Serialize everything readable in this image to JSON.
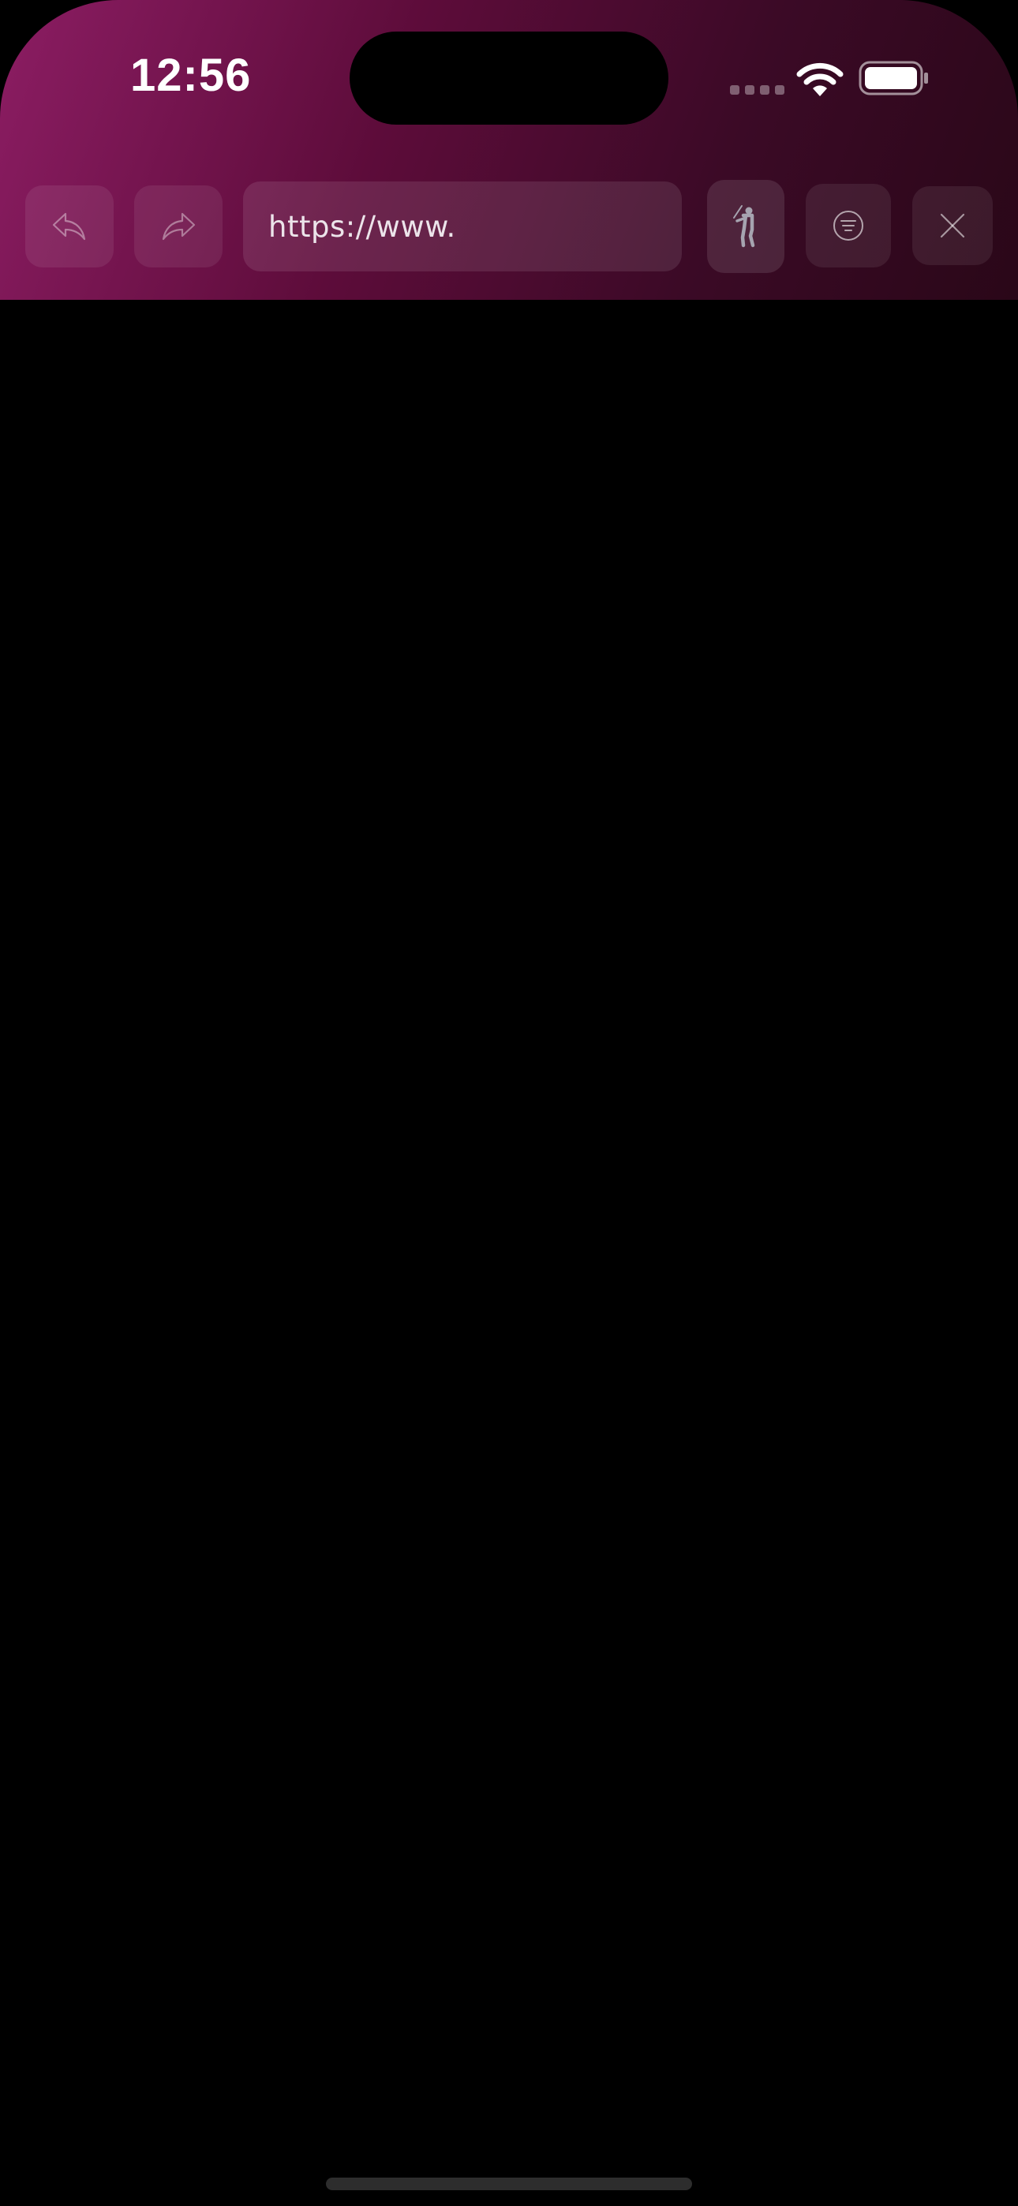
{
  "status_bar": {
    "time": "12:56",
    "icons": [
      "cellular-signal-icon",
      "wifi-icon",
      "battery-icon"
    ]
  },
  "toolbar": {
    "back_icon": "back-arrow-icon",
    "forward_icon": "forward-arrow-icon",
    "url": "https://www.",
    "golf_icon": "golfer-icon",
    "menu_icon": "menu-circle-icon",
    "close_icon": "close-icon"
  },
  "colors": {
    "header_gradient_start": "#8c1d63",
    "header_gradient_end": "#2a0718",
    "content_background": "#000000",
    "text": "#ffffff"
  }
}
